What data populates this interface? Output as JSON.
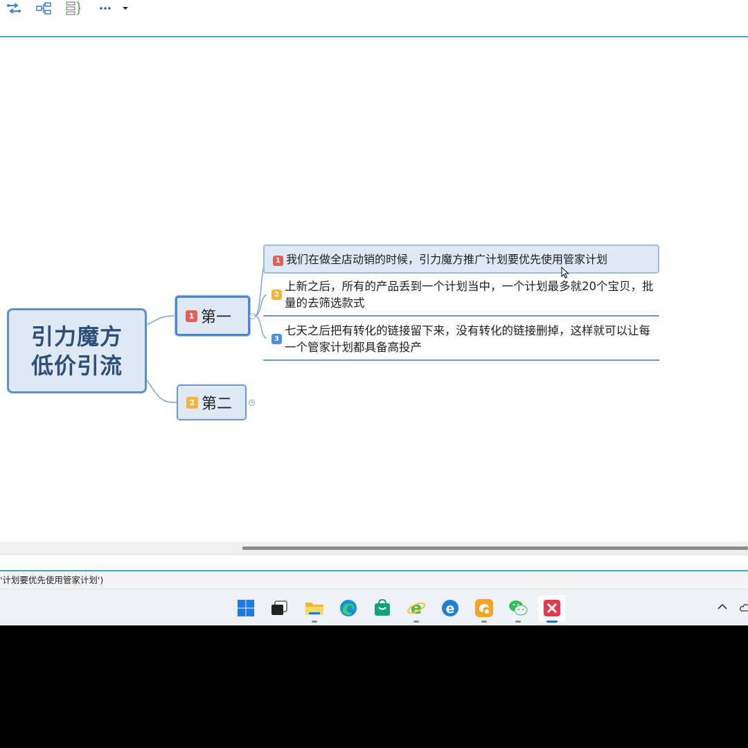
{
  "toolbar": {
    "icons": [
      "relationship-icon",
      "structure-icon",
      "summary-icon",
      "more-icon",
      "dropdown-arrow-icon"
    ]
  },
  "mindmap": {
    "central_topic": {
      "line1": "引力魔方",
      "line2": "低价引流"
    },
    "main_topics": [
      {
        "num": "1",
        "label": "第一",
        "selected": true,
        "subtopics": [
          {
            "num": "1",
            "text": "我们在做全店动销的时候，引力魔方推广计划要优先使用管家计划"
          },
          {
            "num": "2",
            "text": "上新之后，所有的产品丢到一个计划当中，一个计划最多就20个宝贝，批量的去筛选款式"
          },
          {
            "num": "3",
            "text": "七天之后把有转化的链接留下来，没有转化的链接删掉，这样就可以让每一个管家计划都具备高投产"
          }
        ]
      },
      {
        "num": "2",
        "label": "第二",
        "selected": false
      }
    ]
  },
  "statusbar": {
    "text": "'计划要优先使用管家计划')"
  },
  "taskbar": {
    "items": [
      "windows-start",
      "task-view",
      "file-explorer",
      "edge",
      "store",
      "ie",
      "edge-legacy",
      "uc-browser",
      "wechat",
      "xmind"
    ],
    "active": "xmind"
  },
  "colors": {
    "accent": "#3ea6c9",
    "topic_fill": "#dfe8f5",
    "topic_border": "#5b8fd2",
    "central_text": "#2e4f7a",
    "marker_red": "#e06155",
    "marker_orange": "#f3b33d",
    "marker_blue": "#4f8ee0"
  }
}
